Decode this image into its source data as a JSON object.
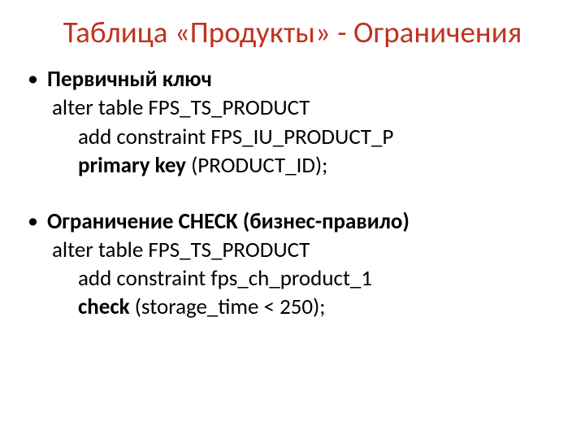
{
  "title": "Таблица «Продукты» - Ограничения",
  "section1": {
    "heading": "Первичный ключ",
    "line1": "alter table  FPS_TS_PRODUCT",
    "line2_a": "add constraint  FPS_IU_PRODUCT_P",
    "line3_kw": "primary key",
    "line3_rest": " (PRODUCT_ID);"
  },
  "section2": {
    "heading": "Ограничение CHECK  (бизнес-правило)",
    "line1": "alter table FPS_TS_PRODUCT",
    "line2": "add constraint fps_ch_product_1",
    "line3_kw": "check",
    "line3_rest": " (storage_time < 250);"
  }
}
